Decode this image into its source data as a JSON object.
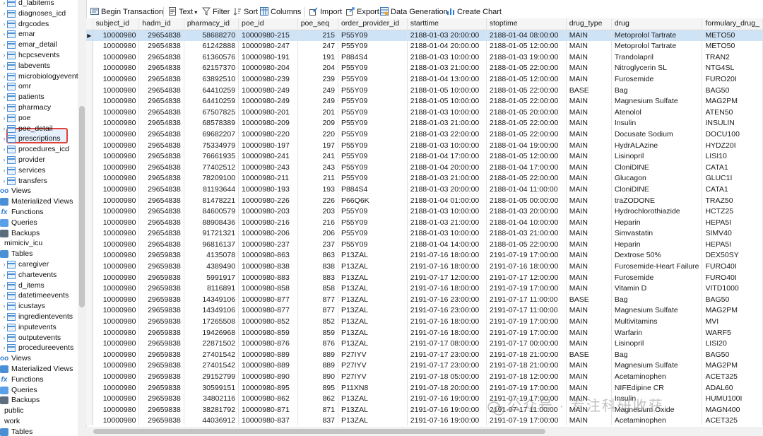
{
  "sidebar": {
    "items": [
      {
        "label": "d_labitems",
        "icon": "table-icon",
        "type": "table",
        "level": 1,
        "chevron": true
      },
      {
        "label": "diagnoses_icd",
        "icon": "table-icon",
        "type": "table",
        "level": 1,
        "chevron": true
      },
      {
        "label": "drgcodes",
        "icon": "table-icon",
        "type": "table",
        "level": 1,
        "chevron": true
      },
      {
        "label": "emar",
        "icon": "table-icon",
        "type": "table",
        "level": 1,
        "chevron": true
      },
      {
        "label": "emar_detail",
        "icon": "table-icon",
        "type": "table",
        "level": 1,
        "chevron": true
      },
      {
        "label": "hcpcsevents",
        "icon": "table-icon",
        "type": "table",
        "level": 1,
        "chevron": true
      },
      {
        "label": "labevents",
        "icon": "table-icon",
        "type": "table",
        "level": 1,
        "chevron": true
      },
      {
        "label": "microbiologyevents",
        "icon": "table-icon",
        "type": "table",
        "level": 1,
        "chevron": true
      },
      {
        "label": "omr",
        "icon": "table-icon",
        "type": "table",
        "level": 1,
        "chevron": true
      },
      {
        "label": "patients",
        "icon": "table-icon",
        "type": "table",
        "level": 1,
        "chevron": true
      },
      {
        "label": "pharmacy",
        "icon": "table-icon",
        "type": "table",
        "level": 1,
        "chevron": true
      },
      {
        "label": "poe",
        "icon": "table-icon",
        "type": "table",
        "level": 1,
        "chevron": true
      },
      {
        "label": "poe_detail",
        "icon": "table-icon",
        "type": "table",
        "level": 1,
        "chevron": true
      },
      {
        "label": "prescriptions",
        "icon": "table-icon",
        "type": "table",
        "level": 1,
        "chevron": true,
        "selected": true
      },
      {
        "label": "procedures_icd",
        "icon": "table-icon",
        "type": "table",
        "level": 1,
        "chevron": true
      },
      {
        "label": "provider",
        "icon": "table-icon",
        "type": "table",
        "level": 1,
        "chevron": true
      },
      {
        "label": "services",
        "icon": "table-icon",
        "type": "table",
        "level": 1,
        "chevron": true
      },
      {
        "label": "transfers",
        "icon": "table-icon",
        "type": "table",
        "level": 1,
        "chevron": true
      },
      {
        "label": "Views",
        "icon": "view-icon",
        "type": "view",
        "level": 0,
        "chevron": true
      },
      {
        "label": "Materialized Views",
        "icon": "materialized-view-icon",
        "type": "mview",
        "level": 0,
        "chevron": false
      },
      {
        "label": "Functions",
        "icon": "function-icon",
        "type": "func",
        "level": 0,
        "chevron": true
      },
      {
        "label": "Queries",
        "icon": "query-icon",
        "type": "query",
        "level": 0,
        "chevron": false
      },
      {
        "label": "Backups",
        "icon": "backup-icon",
        "type": "backup",
        "level": 0,
        "chevron": false
      },
      {
        "label": "mimiciv_icu",
        "icon": "schema-icon",
        "type": "schema",
        "level": -1,
        "chevron": true
      },
      {
        "label": "Tables",
        "icon": "tables-icon",
        "type": "tables",
        "level": 0,
        "chevron": true
      },
      {
        "label": "caregiver",
        "icon": "table-icon",
        "type": "table",
        "level": 1,
        "chevron": true
      },
      {
        "label": "chartevents",
        "icon": "table-icon",
        "type": "table",
        "level": 1,
        "chevron": true
      },
      {
        "label": "d_items",
        "icon": "table-icon",
        "type": "table",
        "level": 1,
        "chevron": true
      },
      {
        "label": "datetimeevents",
        "icon": "table-icon",
        "type": "table",
        "level": 1,
        "chevron": true
      },
      {
        "label": "icustays",
        "icon": "table-icon",
        "type": "table",
        "level": 1,
        "chevron": true
      },
      {
        "label": "ingredientevents",
        "icon": "table-icon",
        "type": "table",
        "level": 1,
        "chevron": true
      },
      {
        "label": "inputevents",
        "icon": "table-icon",
        "type": "table",
        "level": 1,
        "chevron": true
      },
      {
        "label": "outputevents",
        "icon": "table-icon",
        "type": "table",
        "level": 1,
        "chevron": true
      },
      {
        "label": "procedureevents",
        "icon": "table-icon",
        "type": "table",
        "level": 1,
        "chevron": true
      },
      {
        "label": "Views",
        "icon": "view-icon",
        "type": "view",
        "level": 0,
        "chevron": true
      },
      {
        "label": "Materialized Views",
        "icon": "materialized-view-icon",
        "type": "mview",
        "level": 0,
        "chevron": false
      },
      {
        "label": "Functions",
        "icon": "function-icon",
        "type": "func",
        "level": 0,
        "chevron": true
      },
      {
        "label": "Queries",
        "icon": "query-icon",
        "type": "query",
        "level": 0,
        "chevron": false
      },
      {
        "label": "Backups",
        "icon": "backup-icon",
        "type": "backup",
        "level": 0,
        "chevron": false
      },
      {
        "label": "public",
        "icon": "schema-icon",
        "type": "schema",
        "level": -1,
        "chevron": true
      },
      {
        "label": "work",
        "icon": "schema-icon",
        "type": "schema",
        "level": -1,
        "chevron": true
      },
      {
        "label": "Tables",
        "icon": "tables-icon",
        "type": "tables",
        "level": 0,
        "chevron": true
      }
    ]
  },
  "toolbar": {
    "begin_transaction": "Begin Transaction",
    "text": "Text",
    "filter": "Filter",
    "sort": "Sort",
    "columns": "Columns",
    "import": "Import",
    "export": "Export",
    "data_generation": "Data Generation",
    "create_chart": "Create Chart"
  },
  "grid": {
    "columns": [
      "subject_id",
      "hadm_id",
      "pharmacy_id",
      "poe_id",
      "poe_seq",
      "order_provider_id",
      "starttime",
      "stoptime",
      "drug_type",
      "drug",
      "formulary_drug_"
    ],
    "rows": [
      [
        "10000980",
        "29654838",
        "58688270",
        "10000980-215",
        "215",
        "P55Y09",
        "2188-01-03 20:00:00",
        "2188-01-04 08:00:00",
        "MAIN",
        "Metoprolol Tartrate",
        "METO50"
      ],
      [
        "10000980",
        "29654838",
        "61242888",
        "10000980-247",
        "247",
        "P55Y09",
        "2188-01-04 20:00:00",
        "2188-01-05 12:00:00",
        "MAIN",
        "Metoprolol Tartrate",
        "METO50"
      ],
      [
        "10000980",
        "29654838",
        "61360576",
        "10000980-191",
        "191",
        "P884S4",
        "2188-01-03 10:00:00",
        "2188-01-03 19:00:00",
        "MAIN",
        "Trandolapril",
        "TRAN2"
      ],
      [
        "10000980",
        "29654838",
        "62157370",
        "10000980-204",
        "204",
        "P55Y09",
        "2188-01-03 21:00:00",
        "2188-01-05 22:00:00",
        "MAIN",
        "Nitroglycerin SL",
        "NTG4SL"
      ],
      [
        "10000980",
        "29654838",
        "63892510",
        "10000980-239",
        "239",
        "P55Y09",
        "2188-01-04 13:00:00",
        "2188-01-05 12:00:00",
        "MAIN",
        "Furosemide",
        "FURO20I"
      ],
      [
        "10000980",
        "29654838",
        "64410259",
        "10000980-249",
        "249",
        "P55Y09",
        "2188-01-05 10:00:00",
        "2188-01-05 22:00:00",
        "BASE",
        "Bag",
        "BAG50"
      ],
      [
        "10000980",
        "29654838",
        "64410259",
        "10000980-249",
        "249",
        "P55Y09",
        "2188-01-05 10:00:00",
        "2188-01-05 22:00:00",
        "MAIN",
        "Magnesium Sulfate",
        "MAG2PM"
      ],
      [
        "10000980",
        "29654838",
        "67507825",
        "10000980-201",
        "201",
        "P55Y09",
        "2188-01-03 10:00:00",
        "2188-01-05 20:00:00",
        "MAIN",
        "Atenolol",
        "ATEN50"
      ],
      [
        "10000980",
        "29654838",
        "68578389",
        "10000980-209",
        "209",
        "P55Y09",
        "2188-01-03 21:00:00",
        "2188-01-05 22:00:00",
        "MAIN",
        "Insulin",
        "INSULIN"
      ],
      [
        "10000980",
        "29654838",
        "69682207",
        "10000980-220",
        "220",
        "P55Y09",
        "2188-01-03 22:00:00",
        "2188-01-05 22:00:00",
        "MAIN",
        "Docusate Sodium",
        "DOCU100"
      ],
      [
        "10000980",
        "29654838",
        "75334979",
        "10000980-197",
        "197",
        "P55Y09",
        "2188-01-03 10:00:00",
        "2188-01-04 19:00:00",
        "MAIN",
        "HydrALAzine",
        "HYDZ20I"
      ],
      [
        "10000980",
        "29654838",
        "76661935",
        "10000980-241",
        "241",
        "P55Y09",
        "2188-01-04 17:00:00",
        "2188-01-05 12:00:00",
        "MAIN",
        "Lisinopril",
        "LISI10"
      ],
      [
        "10000980",
        "29654838",
        "77402512",
        "10000980-243",
        "243",
        "P55Y09",
        "2188-01-04 20:00:00",
        "2188-01-04 17:00:00",
        "MAIN",
        "CloniDINE",
        "CATA1"
      ],
      [
        "10000980",
        "29654838",
        "78209100",
        "10000980-211",
        "211",
        "P55Y09",
        "2188-01-03 21:00:00",
        "2188-01-05 22:00:00",
        "MAIN",
        "Glucagon",
        "GLUC1I"
      ],
      [
        "10000980",
        "29654838",
        "81193644",
        "10000980-193",
        "193",
        "P884S4",
        "2188-01-03 20:00:00",
        "2188-01-04 11:00:00",
        "MAIN",
        "CloniDINE",
        "CATA1"
      ],
      [
        "10000980",
        "29654838",
        "81478221",
        "10000980-226",
        "226",
        "P66Q6K",
        "2188-01-04 01:00:00",
        "2188-01-05 00:00:00",
        "MAIN",
        "traZODONE",
        "TRAZ50"
      ],
      [
        "10000980",
        "29654838",
        "84600579",
        "10000980-203",
        "203",
        "P55Y09",
        "2188-01-03 10:00:00",
        "2188-01-03 20:00:00",
        "MAIN",
        "Hydrochlorothiazide",
        "HCTZ25"
      ],
      [
        "10000980",
        "29654838",
        "88908436",
        "10000980-216",
        "216",
        "P55Y09",
        "2188-01-03 21:00:00",
        "2188-01-04 10:00:00",
        "MAIN",
        "Heparin",
        "HEPA5I"
      ],
      [
        "10000980",
        "29654838",
        "91721321",
        "10000980-206",
        "206",
        "P55Y09",
        "2188-01-03 10:00:00",
        "2188-01-03 21:00:00",
        "MAIN",
        "Simvastatin",
        "SIMV40"
      ],
      [
        "10000980",
        "29654838",
        "96816137",
        "10000980-237",
        "237",
        "P55Y09",
        "2188-01-04 14:00:00",
        "2188-01-05 22:00:00",
        "MAIN",
        "Heparin",
        "HEPA5I"
      ],
      [
        "10000980",
        "29659838",
        "4135078",
        "10000980-863",
        "863",
        "P13ZAL",
        "2191-07-16 18:00:00",
        "2191-07-19 17:00:00",
        "MAIN",
        "Dextrose 50%",
        "DEX50SY"
      ],
      [
        "10000980",
        "29659838",
        "4389490",
        "10000980-838",
        "838",
        "P13ZAL",
        "2191-07-16 18:00:00",
        "2191-07-16 18:00:00",
        "MAIN",
        "Furosemide-Heart Failure",
        "FURO40I"
      ],
      [
        "10000980",
        "29659838",
        "5991917",
        "10000980-883",
        "883",
        "P13ZAL",
        "2191-07-17 12:00:00",
        "2191-07-17 12:00:00",
        "MAIN",
        "Furosemide",
        "FURO40I"
      ],
      [
        "10000980",
        "29659838",
        "8116891",
        "10000980-858",
        "858",
        "P13ZAL",
        "2191-07-16 18:00:00",
        "2191-07-19 17:00:00",
        "MAIN",
        "Vitamin D",
        "VITD1000"
      ],
      [
        "10000980",
        "29659838",
        "14349106",
        "10000980-877",
        "877",
        "P13ZAL",
        "2191-07-16 23:00:00",
        "2191-07-17 11:00:00",
        "BASE",
        "Bag",
        "BAG50"
      ],
      [
        "10000980",
        "29659838",
        "14349106",
        "10000980-877",
        "877",
        "P13ZAL",
        "2191-07-16 23:00:00",
        "2191-07-17 11:00:00",
        "MAIN",
        "Magnesium Sulfate",
        "MAG2PM"
      ],
      [
        "10000980",
        "29659838",
        "17265508",
        "10000980-852",
        "852",
        "P13ZAL",
        "2191-07-16 18:00:00",
        "2191-07-19 17:00:00",
        "MAIN",
        "Multivitamins",
        "MVI"
      ],
      [
        "10000980",
        "29659838",
        "19426968",
        "10000980-859",
        "859",
        "P13ZAL",
        "2191-07-16 18:00:00",
        "2191-07-19 17:00:00",
        "MAIN",
        "Warfarin",
        "WARF5"
      ],
      [
        "10000980",
        "29659838",
        "22871502",
        "10000980-876",
        "876",
        "P13ZAL",
        "2191-07-17 08:00:00",
        "2191-07-17 00:00:00",
        "MAIN",
        "Lisinopril",
        "LISI20"
      ],
      [
        "10000980",
        "29659838",
        "27401542",
        "10000980-889",
        "889",
        "P27IYV",
        "2191-07-17 23:00:00",
        "2191-07-18 21:00:00",
        "BASE",
        "Bag",
        "BAG50"
      ],
      [
        "10000980",
        "29659838",
        "27401542",
        "10000980-889",
        "889",
        "P27IYV",
        "2191-07-17 23:00:00",
        "2191-07-18 21:00:00",
        "MAIN",
        "Magnesium Sulfate",
        "MAG2PM"
      ],
      [
        "10000980",
        "29659838",
        "29152799",
        "10000980-890",
        "890",
        "P27IYV",
        "2191-07-18 05:00:00",
        "2191-07-18 12:00:00",
        "MAIN",
        "Acetaminophen",
        "ACET325"
      ],
      [
        "10000980",
        "29659838",
        "30599151",
        "10000980-895",
        "895",
        "P11XN8",
        "2191-07-18 20:00:00",
        "2191-07-19 17:00:00",
        "MAIN",
        "NIFEdipine CR",
        "ADAL60"
      ],
      [
        "10000980",
        "29659838",
        "34802116",
        "10000980-862",
        "862",
        "P13ZAL",
        "2191-07-16 19:00:00",
        "2191-07-19 17:00:00",
        "MAIN",
        "Insulin",
        "HUMU100I"
      ],
      [
        "10000980",
        "29659838",
        "38281792",
        "10000980-871",
        "871",
        "P13ZAL",
        "2191-07-16 19:00:00",
        "2191-07-17 11:00:00",
        "MAIN",
        "Magnesium Oxide",
        "MAGN400"
      ],
      [
        "10000980",
        "29659838",
        "44036912",
        "10000980-837",
        "837",
        "P13ZAL",
        "2191-07-16 19:00:00",
        "2191-07-19 17:00:00",
        "MAIN",
        "Acetaminophen",
        "ACET325"
      ]
    ],
    "selected_row": 0
  },
  "watermark": {
    "text": "公众号 · 专注科研收获"
  },
  "colors": {
    "accent": "#2d7bd0",
    "selection": "#cfe3f7",
    "highlight_border": "#e0413a"
  }
}
